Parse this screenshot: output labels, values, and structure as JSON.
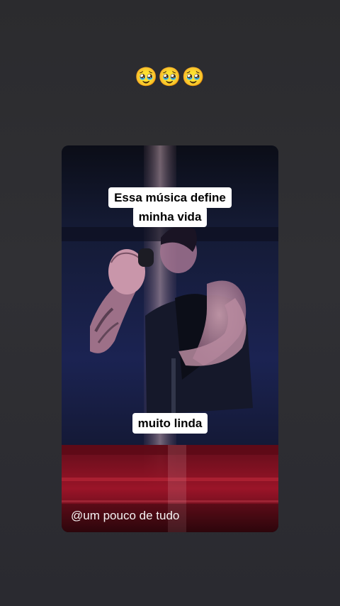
{
  "story": {
    "emoji_text": "🥹🥹🥹",
    "caption_top_line1": "Essa música define",
    "caption_top_line2": "minha vida",
    "caption_bottom": "muito linda",
    "watermark": "@um pouco de tudo"
  },
  "colors": {
    "background": "#2b2b2e",
    "caption_bg": "#ffffff",
    "caption_text": "#000000",
    "video_dark": "#0c0f1c",
    "stage_red": "#8a1020"
  },
  "icons": {
    "emoji": "pleading-face-holding-back-tears"
  }
}
